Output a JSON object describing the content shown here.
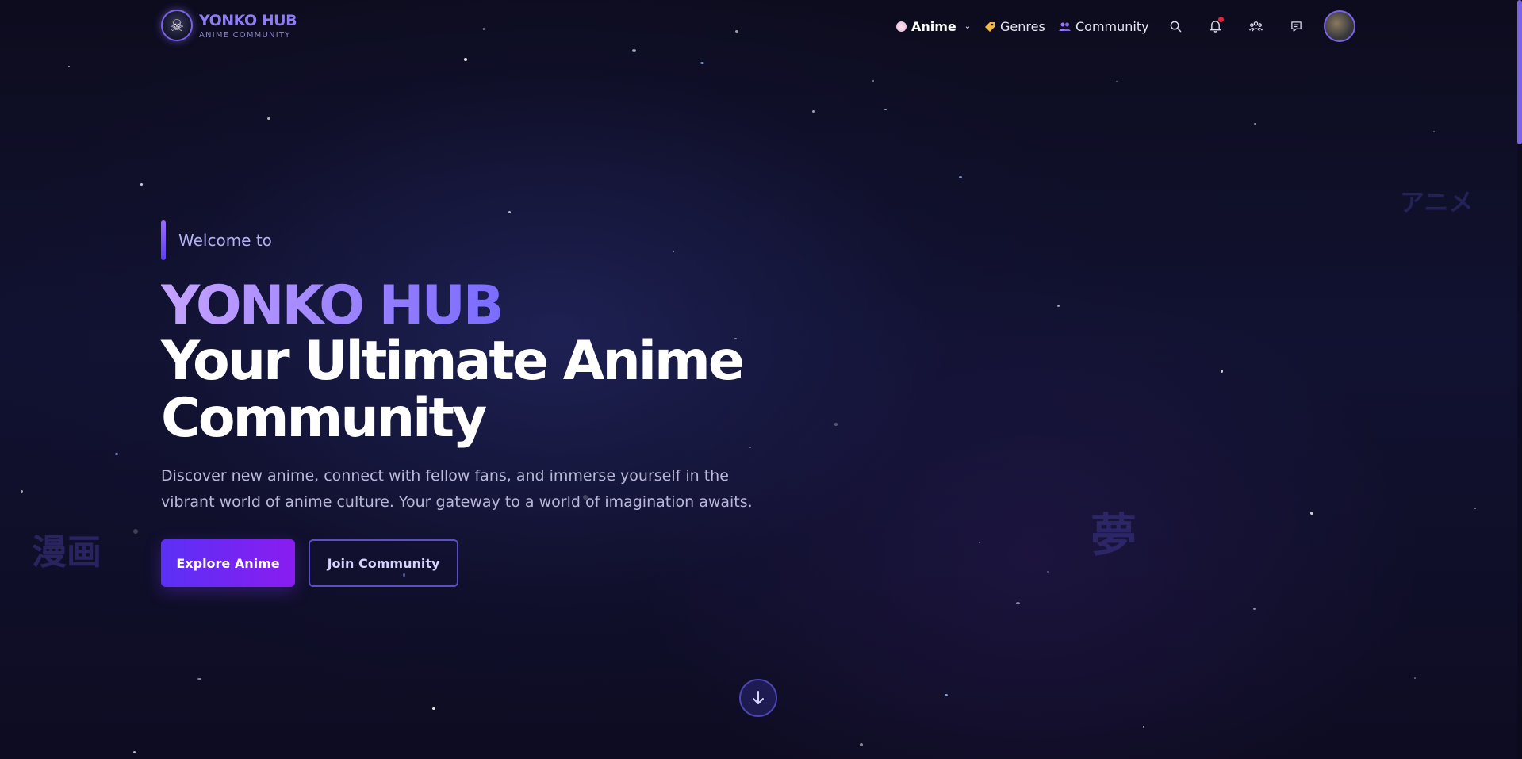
{
  "brand": {
    "name": "YONKO HUB",
    "tagline": "ANIME COMMUNITY",
    "logo_icon": "skull-logo-icon"
  },
  "nav": {
    "items": [
      {
        "label": "Anime",
        "icon": "anime-dot-icon",
        "icon_color": "#e8b3d6",
        "active": true,
        "has_dropdown": true
      },
      {
        "label": "Genres",
        "icon": "tag-icon",
        "icon_color": "#f5b942"
      },
      {
        "label": "Community",
        "icon": "users-icon",
        "icon_color": "#9b7cf5"
      }
    ],
    "icons": [
      "search-icon",
      "bell-icon",
      "groups-icon",
      "chat-icon"
    ],
    "has_notification": true
  },
  "hero": {
    "welcome": "Welcome to",
    "title_brand": "YONKO HUB",
    "title_main": "Your Ultimate Anime Community",
    "description": "Discover new anime, connect with fellow fans, and immerse yourself in the vibrant world of anime culture. Your gateway to a world of imagination awaits.",
    "primary_button": "Explore Anime",
    "secondary_button": "Join Community"
  },
  "decor": {
    "kanji_manga": "漫画",
    "kanji_dream": "夢",
    "katakana_anime": "アニメ"
  },
  "colors": {
    "accent": "#7b63e6",
    "primary_gradient_start": "#5b30f5",
    "primary_gradient_end": "#8a1cf0",
    "notification": "#e0243a"
  }
}
